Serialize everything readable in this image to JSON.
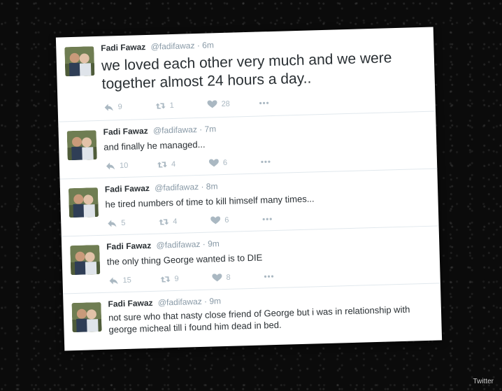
{
  "tweets": [
    {
      "name": "Fadi Fawaz",
      "handle": "@fadifawaz",
      "time": "· 6m",
      "text": "we loved each other very much and we were together almost 24 hours a day..",
      "replies": "9",
      "retweets": "1",
      "likes": "28"
    },
    {
      "name": "Fadi Fawaz",
      "handle": "@fadifawaz",
      "time": "· 7m",
      "text": "and finally he managed...",
      "replies": "10",
      "retweets": "4",
      "likes": "6"
    },
    {
      "name": "Fadi Fawaz",
      "handle": "@fadifawaz",
      "time": "· 8m",
      "text": "he tired numbers of time to kill himself many times...",
      "replies": "5",
      "retweets": "4",
      "likes": "6"
    },
    {
      "name": "Fadi Fawaz",
      "handle": "@fadifawaz",
      "time": "· 9m",
      "text": "the only thing George wanted is to DIE",
      "replies": "15",
      "retweets": "9",
      "likes": "8"
    },
    {
      "name": "Fadi Fawaz",
      "handle": "@fadifawaz",
      "time": "· 9m",
      "text": "not sure who that nasty close friend of George but i was in relationship with george micheal till i found him dead in bed."
    }
  ],
  "credit": "Twitter",
  "icons": {
    "reply": "reply-icon",
    "retweet": "retweet-icon",
    "like": "heart-icon",
    "more": "more-icon"
  }
}
